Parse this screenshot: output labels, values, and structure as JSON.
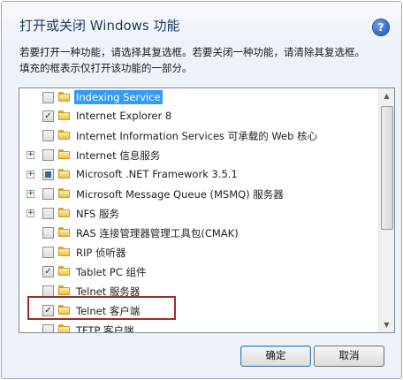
{
  "dialog": {
    "title": "打开或关闭 Windows 功能",
    "help_icon_glyph": "?",
    "description_lines": [
      "若要打开一种功能，请选择其复选框。若要关闭一种功能，请清除其复选框。",
      "填充的框表示仅打开该功能的一部分。"
    ]
  },
  "features": [
    {
      "label": "Indexing Service",
      "checkbox": "unchecked",
      "expander": "",
      "selected": true
    },
    {
      "label": "Internet Explorer 8",
      "checkbox": "checked",
      "expander": ""
    },
    {
      "label": "Internet Information Services 可承载的 Web 核心",
      "checkbox": "unchecked",
      "expander": ""
    },
    {
      "label": "Internet 信息服务",
      "checkbox": "unchecked",
      "expander": "+"
    },
    {
      "label": "Microsoft .NET Framework 3.5.1",
      "checkbox": "partial",
      "expander": "+"
    },
    {
      "label": "Microsoft Message Queue (MSMQ) 服务器",
      "checkbox": "unchecked",
      "expander": "+"
    },
    {
      "label": "NFS 服务",
      "checkbox": "unchecked",
      "expander": "+"
    },
    {
      "label": "RAS 连接管理器管理工具包(CMAK)",
      "checkbox": "unchecked",
      "expander": ""
    },
    {
      "label": "RIP 侦听器",
      "checkbox": "unchecked",
      "expander": ""
    },
    {
      "label": "Tablet PC 组件",
      "checkbox": "checked",
      "expander": ""
    },
    {
      "label": "Telnet 服务器",
      "checkbox": "unchecked",
      "expander": ""
    },
    {
      "label": "Telnet 客户端",
      "checkbox": "checked",
      "expander": "",
      "highlighted": true
    },
    {
      "label": "TFTP 客户端",
      "checkbox": "unchecked",
      "expander": ""
    }
  ],
  "buttons": {
    "ok": "确定",
    "cancel": "取消"
  },
  "scrollbar": {
    "up_glyph": "▲",
    "down_glyph": "▼"
  },
  "colors": {
    "selection": "#3399ff",
    "highlight_border": "#9b2d2d"
  }
}
